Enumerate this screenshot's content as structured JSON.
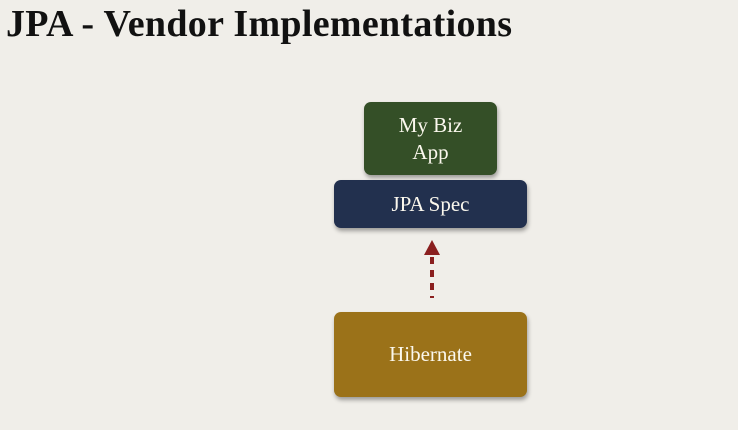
{
  "title": "JPA - Vendor Implementations",
  "boxes": {
    "app_line1": "My Biz",
    "app_line2": "App",
    "spec": "JPA Spec",
    "hibernate": "Hibernate"
  },
  "colors": {
    "app": "#344f27",
    "spec": "#22304e",
    "hibernate": "#9b7219",
    "arrow": "#8a1f1f"
  }
}
